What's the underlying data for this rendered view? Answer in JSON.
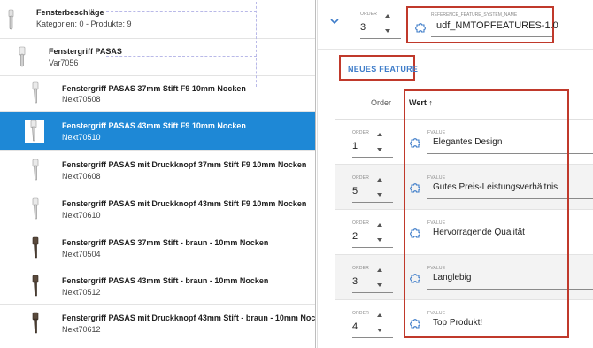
{
  "tree": {
    "root": {
      "title": "Fensterbeschläge",
      "subtitle": "Kategorien: 0 - Produkte: 9"
    },
    "parent": {
      "title": "Fenstergriff PASAS",
      "subtitle": "Var7056"
    },
    "items": [
      {
        "title": "Fenstergriff PASAS 37mm Stift F9 10mm Nocken",
        "subtitle": "Next70508",
        "selected": false,
        "thumb": "silver-handle"
      },
      {
        "title": "Fenstergriff PASAS 43mm Stift F9 10mm Nocken",
        "subtitle": "Next70510",
        "selected": true,
        "thumb": "silver-handle"
      },
      {
        "title": "Fenstergriff PASAS mit Druckknopf 37mm Stift F9 10mm Nocken",
        "subtitle": "Next70608",
        "selected": false,
        "thumb": "silver-handle"
      },
      {
        "title": "Fenstergriff PASAS mit Druckknopf 43mm Stift F9 10mm Nocken",
        "subtitle": "Next70610",
        "selected": false,
        "thumb": "silver-handle"
      },
      {
        "title": "Fenstergriff PASAS 37mm Stift - braun - 10mm Nocken",
        "subtitle": "Next70504",
        "selected": false,
        "thumb": "brown-handle"
      },
      {
        "title": "Fenstergriff PASAS 43mm Stift - braun - 10mm Nocken",
        "subtitle": "Next70512",
        "selected": false,
        "thumb": "brown-handle"
      },
      {
        "title": "Fenstergriff PASAS mit Druckknopf 43mm Stift - braun - 10mm Nocker",
        "subtitle": "Next70612",
        "selected": false,
        "thumb": "brown-handle"
      }
    ]
  },
  "detail": {
    "header": {
      "order_label": "ORDER",
      "order_value": "3",
      "reference_label": "REFERENCE_FEATURE_SYSTEM_NAME",
      "reference_value": "udf_NMTOPFEATURES-1.0"
    },
    "new_feature_label": "NEUES FEATURE",
    "columns": {
      "order": "Order",
      "wert": "Wert ↑"
    },
    "rows": [
      {
        "order_label": "ORDER",
        "order": "1",
        "fvalue_label": "FVALUE",
        "value": "Elegantes Design"
      },
      {
        "order_label": "ORDER",
        "order": "5",
        "fvalue_label": "FVALUE",
        "value": "Gutes Preis-Leistungsverhältnis"
      },
      {
        "order_label": "ORDER",
        "order": "2",
        "fvalue_label": "FVALUE",
        "value": "Hervorragende Qualität"
      },
      {
        "order_label": "ORDER",
        "order": "3",
        "fvalue_label": "FVALUE",
        "value": "Langlebig"
      },
      {
        "order_label": "ORDER",
        "order": "4",
        "fvalue_label": "FVALUE",
        "value": "Top Produkt!"
      }
    ]
  },
  "colors": {
    "selected_row": "#1e88d6",
    "highlight_border": "#c0392b",
    "button_text": "#3e7cc9",
    "puzzle_icon": "#3e7cc9"
  }
}
